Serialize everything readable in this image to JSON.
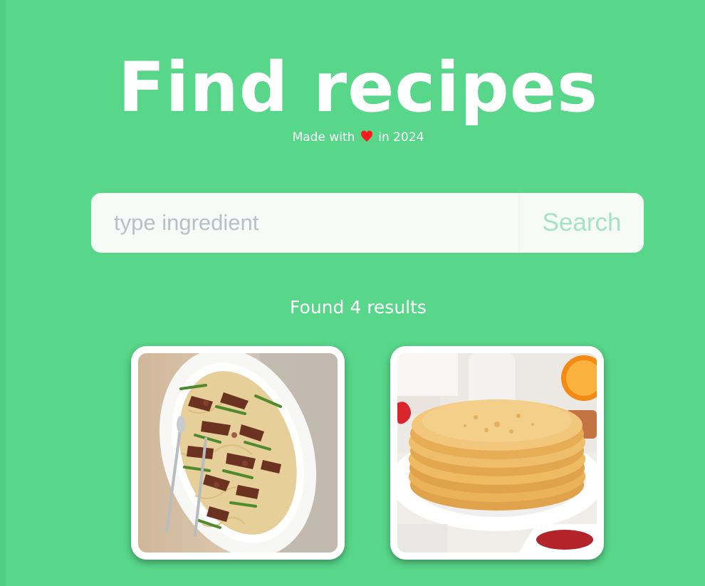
{
  "header": {
    "title": "Find recipes",
    "subtitle_before": "Made with",
    "subtitle_after": "in 2024",
    "heart_icon": "heart-icon",
    "heart_color": "#ff1a1a"
  },
  "search": {
    "placeholder": "type ingredient",
    "value": "",
    "button_label": "Search"
  },
  "results": {
    "text": "Found 4 results"
  },
  "recipes": [
    {
      "image": "beef-asparagus-noodles-photo"
    },
    {
      "image": "pancake-stack-photo"
    }
  ],
  "colors": {
    "background": "#58d68a",
    "search_button_text": "#a6e3c6",
    "placeholder": "#b9bfc4"
  }
}
